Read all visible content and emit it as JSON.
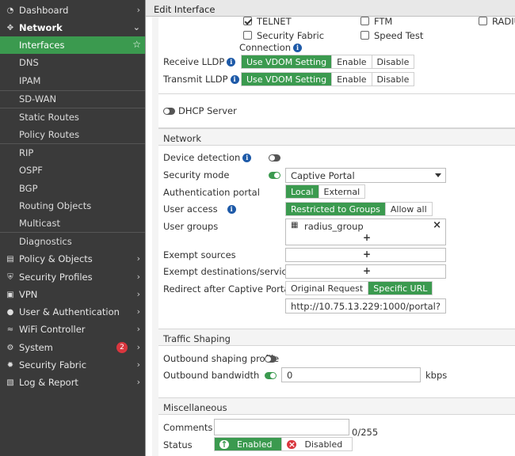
{
  "sidebar": {
    "items": [
      {
        "label": "Dashboard",
        "icon": "dashboard-icon"
      },
      {
        "label": "Network",
        "icon": "network-icon"
      },
      {
        "label": "Interfaces"
      },
      {
        "label": "DNS"
      },
      {
        "label": "IPAM"
      },
      {
        "label": "SD-WAN"
      },
      {
        "label": "Static Routes"
      },
      {
        "label": "Policy Routes"
      },
      {
        "label": "RIP"
      },
      {
        "label": "OSPF"
      },
      {
        "label": "BGP"
      },
      {
        "label": "Routing Objects"
      },
      {
        "label": "Multicast"
      },
      {
        "label": "Diagnostics"
      },
      {
        "label": "Policy & Objects",
        "icon": "policy-icon"
      },
      {
        "label": "Security Profiles",
        "icon": "security-profiles-icon"
      },
      {
        "label": "VPN",
        "icon": "vpn-icon"
      },
      {
        "label": "User & Authentication",
        "icon": "user-icon"
      },
      {
        "label": "WiFi Controller",
        "icon": "wifi-icon"
      },
      {
        "label": "System",
        "icon": "gear-icon",
        "badge": "2"
      },
      {
        "label": "Security Fabric",
        "icon": "security-fabric-icon"
      },
      {
        "label": "Log & Report",
        "icon": "log-report-icon"
      }
    ]
  },
  "dialog": {
    "title": "Edit Interface",
    "access": {
      "telnet": "TELNET",
      "ftm": "FTM",
      "radius": "RADIU",
      "security_fabric_line1": "Security Fabric",
      "security_fabric_line2": "Connection",
      "speed_test": "Speed Test"
    },
    "receive_lldp": {
      "label": "Receive LLDP",
      "options": [
        "Use VDOM Setting",
        "Enable",
        "Disable"
      ]
    },
    "transmit_lldp": {
      "label": "Transmit LLDP",
      "options": [
        "Use VDOM Setting",
        "Enable",
        "Disable"
      ]
    },
    "dhcp_server": "DHCP Server",
    "network": {
      "title": "Network",
      "device_detection": "Device detection",
      "security_mode": "Security mode",
      "security_mode_value": "Captive Portal",
      "authentication_portal": "Authentication portal",
      "auth_options": [
        "Local",
        "External"
      ],
      "user_access": "User access",
      "user_access_options": [
        "Restricted to Groups",
        "Allow all"
      ],
      "user_groups": "User groups",
      "user_group_item": "radius_group",
      "exempt_sources": "Exempt sources",
      "exempt_destinations": "Exempt destinations/services",
      "redirect": "Redirect after Captive Portal",
      "redirect_options": [
        "Original Request",
        "Specific URL"
      ],
      "redirect_url": "http://10.75.13.229:1000/portal?"
    },
    "traffic": {
      "title": "Traffic Shaping",
      "outbound_profile": "Outbound shaping profile",
      "outbound_bandwidth": "Outbound bandwidth",
      "bandwidth_value": "0",
      "bandwidth_unit": "kbps"
    },
    "misc": {
      "title": "Miscellaneous",
      "comments": "Comments",
      "counter": "0/255",
      "status": "Status",
      "enabled": "Enabled",
      "disabled": "Disabled"
    }
  }
}
